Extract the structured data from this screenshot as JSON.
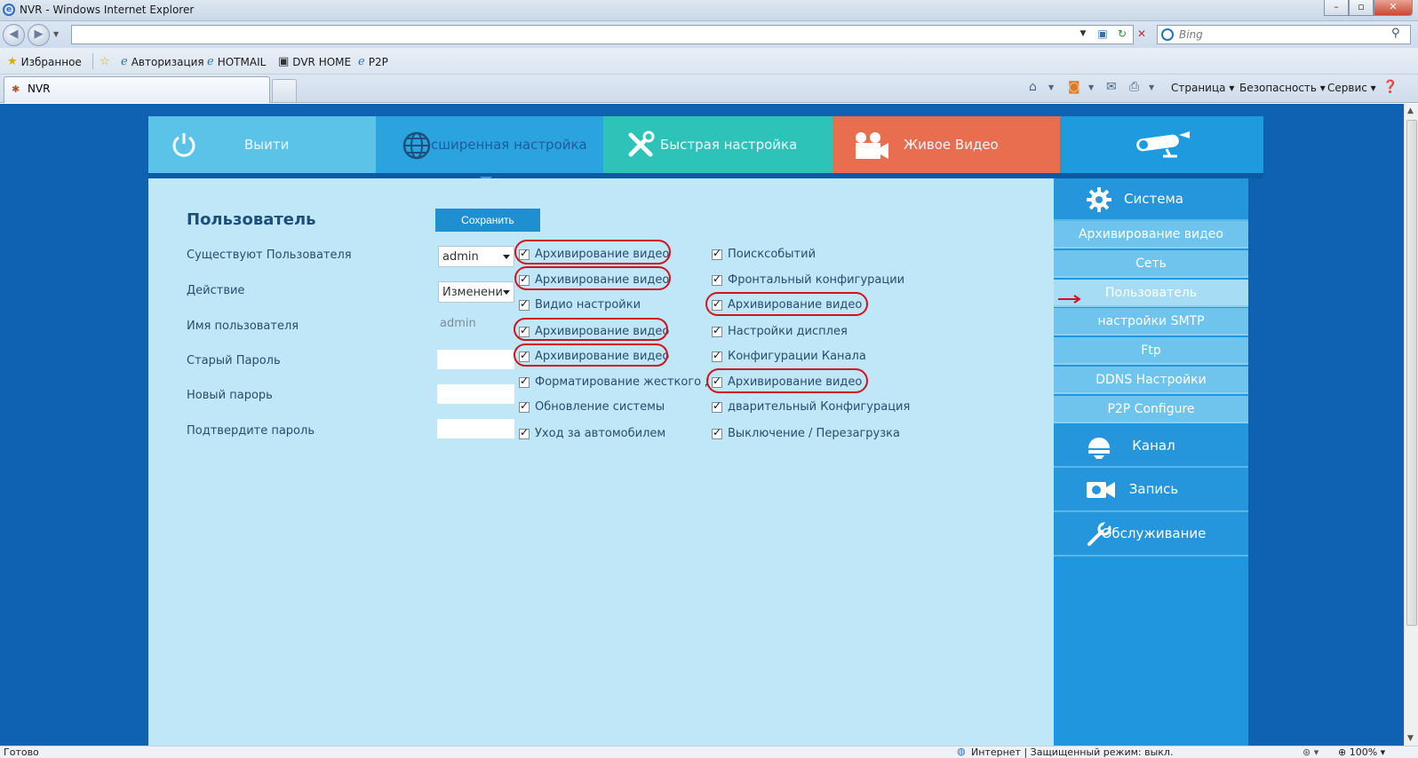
{
  "window": {
    "title": "NVR - Windows Internet Explorer",
    "search_placeholder": "Bing"
  },
  "favorites": {
    "label": "Избранное",
    "links": [
      "Авторизация",
      "HOTMAIL",
      "DVR HOME",
      "P2P"
    ]
  },
  "tab": {
    "label": "NVR"
  },
  "commands": {
    "page": "Страница",
    "security": "Безопасность",
    "tools": "Сервис"
  },
  "nav": {
    "logout": "Выити",
    "advanced": "сширенная настройка",
    "quick": "Быстрая настройка",
    "live": "Живое Видео"
  },
  "form": {
    "title": "Пользователь",
    "save": "Сохранить",
    "labels": [
      "Существуют Пользователя",
      "Действие",
      "Имя пользователя",
      "Старый Пароль",
      "Новый парорь",
      "Подтвердите пароль"
    ],
    "existing_user": "admin",
    "action": "Изменени",
    "username": "admin"
  },
  "permissions": {
    "left": [
      "Архивирование видео",
      "Архивирование видео",
      "Видио настройки",
      "Архивирование видео",
      "Архивирование видео",
      "Форматирование жесткого ди",
      "Обновление системы",
      "Уход за автомобилем"
    ],
    "right": [
      "Поисксобытий",
      "Фронтальный конфигурации",
      "Архивирование видео",
      "Настройки дисплея",
      "Конфигурации Канала",
      "Архивирование видео",
      "дварительный Конфигурация",
      "Выключение / Перезагрузка"
    ]
  },
  "sidebar": {
    "system": "Система",
    "items": [
      "Архивирование видео",
      "Сеть",
      "Пользователь",
      "настройки SMTP",
      "Ftp",
      "DDNS Настройки",
      "P2P Configure"
    ],
    "channel": "Канал",
    "record": "Запись",
    "maintenance": "Обслуживание"
  },
  "status": {
    "left": "Готово",
    "zone": "Интернет | Защищенный режим: выкл.",
    "zoom": "100%"
  },
  "colors": {
    "accent": "#1f8fd2",
    "annotation": "#d3121e",
    "page_bg": "#0f62b1"
  }
}
